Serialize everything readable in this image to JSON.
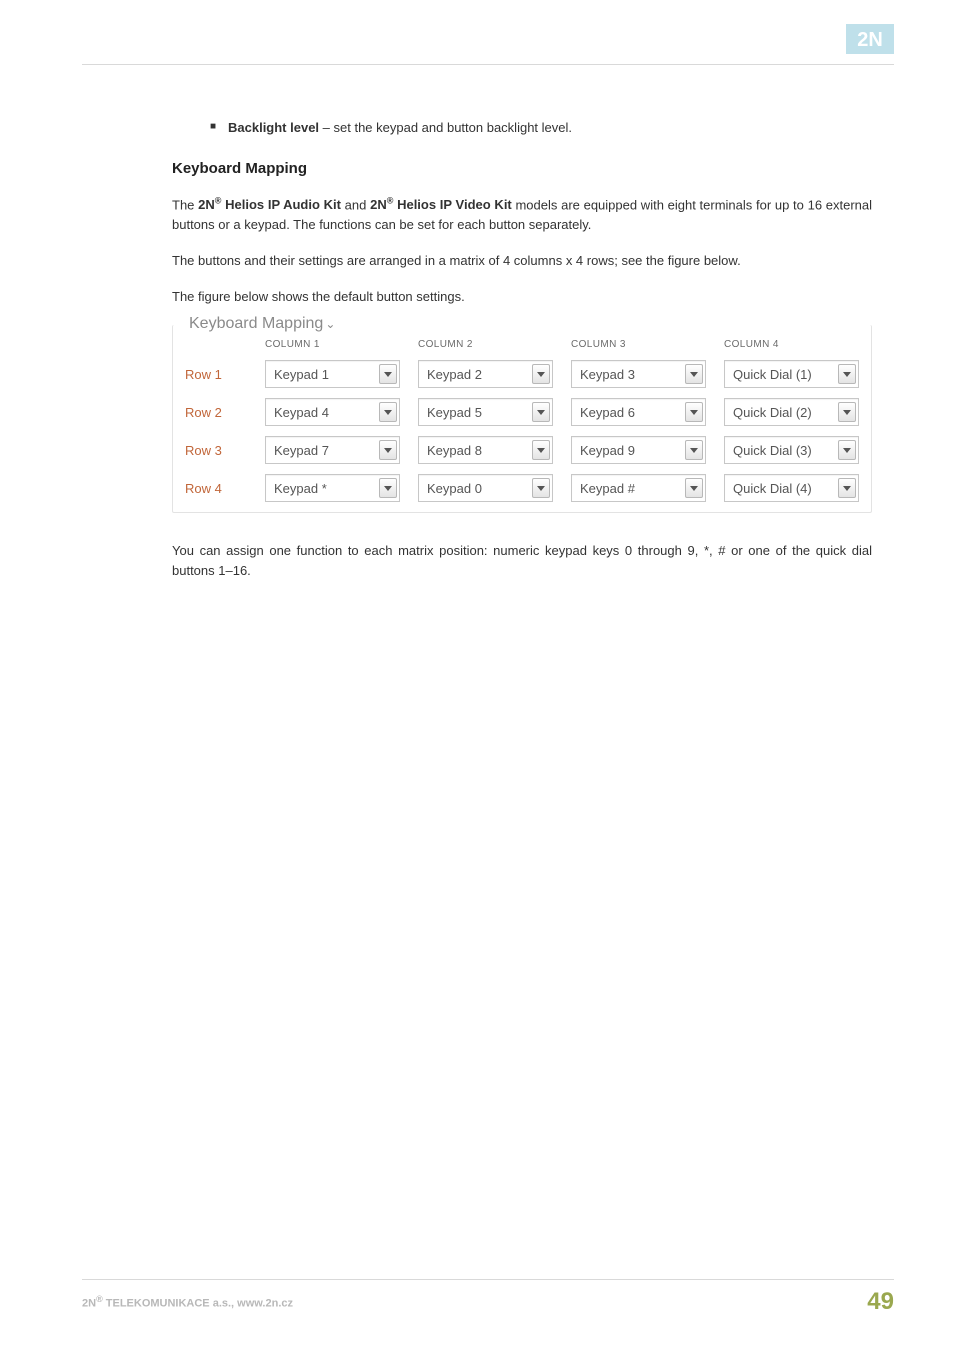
{
  "brand_2n": "2N",
  "bullet": {
    "mark": "■",
    "strong": "Backlight level",
    "rest": " – set the keypad and button backlight level."
  },
  "heading": "Keyboard Mapping",
  "para1": {
    "a": "The ",
    "b": "2N",
    "sup1": "®",
    "c": " Helios IP Audio Kit",
    "d": " and ",
    "e": "2N",
    "sup2": "®",
    "f": " Helios IP Video Kit",
    "g": " models are equipped with eight terminals for up to 16 external buttons or a keypad. The functions can be set for each button separately."
  },
  "para2": "The buttons and their settings are arranged in a matrix of 4 columns x 4 rows; see the figure below.",
  "para3": "The figure below shows the default button settings.",
  "card_title": "Keyboard Mapping",
  "cols": [
    "COLUMN 1",
    "COLUMN 2",
    "COLUMN 3",
    "COLUMN 4"
  ],
  "rows": [
    {
      "label": "Row 1",
      "cells": [
        "Keypad 1",
        "Keypad 2",
        "Keypad 3",
        "Quick Dial (1)"
      ]
    },
    {
      "label": "Row 2",
      "cells": [
        "Keypad 4",
        "Keypad 5",
        "Keypad 6",
        "Quick Dial (2)"
      ]
    },
    {
      "label": "Row 3",
      "cells": [
        "Keypad 7",
        "Keypad 8",
        "Keypad 9",
        "Quick Dial (3)"
      ]
    },
    {
      "label": "Row 4",
      "cells": [
        "Keypad *",
        "Keypad 0",
        "Keypad #",
        "Quick Dial (4)"
      ]
    }
  ],
  "para4": "You can assign one function to each matrix position: numeric keypad keys 0 through 9, *, # or one of the quick dial buttons 1–16.",
  "footer": {
    "left_a": "2N",
    "left_sup": "®",
    "left_b": " TELEKOMUNIKACE a.s., www.2n.cz",
    "page": "49"
  }
}
